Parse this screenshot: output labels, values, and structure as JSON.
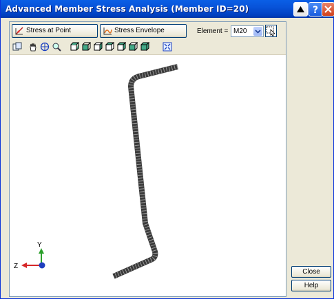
{
  "window": {
    "title": "Advanced Member Stress Analysis (Member ID=20)"
  },
  "topbar": {
    "stress_at_point_label": "Stress at Point",
    "stress_envelope_label": "Stress Envelope",
    "element_label": "Element =",
    "element_value": "M20"
  },
  "toolbar": {
    "icons": [
      "copy-icon",
      "pan-icon",
      "rotate-icon",
      "zoom-icon",
      "view-front-icon",
      "view-back-icon",
      "view-left-icon",
      "view-right-icon",
      "view-top-icon",
      "view-bottom-icon",
      "view-iso-icon",
      "fit-icon"
    ]
  },
  "axes": {
    "y_label": "Y",
    "z_label": "Z"
  },
  "buttons": {
    "close_label": "Close",
    "help_label": "Help"
  },
  "colors": {
    "title_bar": "#0853d9",
    "member": "#3a3a3a",
    "y_axis": "#2ca02c",
    "z_axis": "#d62728",
    "x_axis": "#1f3fbf"
  }
}
